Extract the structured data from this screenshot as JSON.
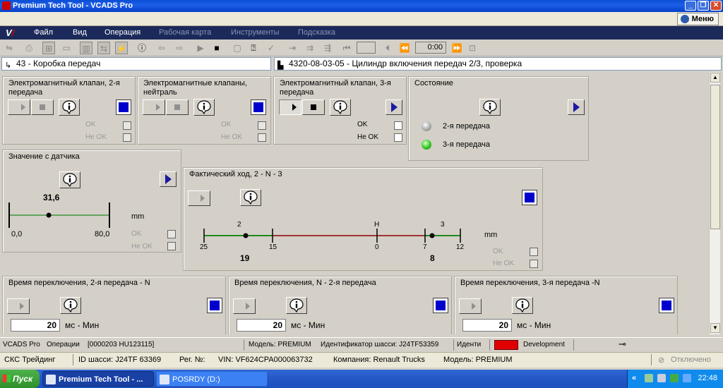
{
  "window": {
    "title": "Premium Tech Tool - VCADS Pro"
  },
  "menu_button": {
    "label": "Меню"
  },
  "menubar": {
    "items": [
      "Файл",
      "Вид",
      "Операция",
      "Рабочая карта",
      "Инструменты",
      "Подсказка"
    ]
  },
  "toolbar": {
    "time": "0:00"
  },
  "path": {
    "left": "43 - Коробка передач",
    "right": "4320-08-03-05 - Цилиндр включения передач 2/3, проверка"
  },
  "panels": {
    "valve2": {
      "title": "Электромагнитный клапан, 2-я передача",
      "ok": "OK",
      "not_ok": "Не OK"
    },
    "valveN": {
      "title": "Электромагнитные клапаны, нейтраль",
      "ok": "OK",
      "not_ok": "Не OK"
    },
    "valve3": {
      "title": "Электромагнитный клапан, 3-я передача",
      "ok": "OK",
      "not_ok": "Не OK"
    },
    "state": {
      "title": "Состояние",
      "gear2": "2-я передача",
      "gear3": "3-я передача",
      "gear2_on": false,
      "gear3_on": true
    },
    "sensor": {
      "title": "Значение с датчика",
      "value": "31,6",
      "min": "0,0",
      "max": "80,0",
      "unit": "mm",
      "ok": "OK",
      "not_ok": "Не OK",
      "position": 31.6,
      "range": [
        0,
        80
      ]
    },
    "stroke": {
      "title": "Фактический ход, 2 - N - 3",
      "unit": "mm",
      "top_labels": {
        "g2": "2",
        "neutral": "Н",
        "g3": "3"
      },
      "ticks": [
        "25",
        "15",
        "0",
        "7",
        "12"
      ],
      "value_left": "19",
      "value_right": "8",
      "ok": "OK",
      "not_ok": "Не OK"
    },
    "time_2n": {
      "title": "Время переключения, 2-я передача - N",
      "value": "20",
      "unit": "мс - Мин"
    },
    "time_n2": {
      "title": "Время переключения, N - 2-я передача",
      "value": "20",
      "unit": "мс - Мин"
    },
    "time_3n": {
      "title": "Время переключения, 3-я передача -N",
      "value": "20",
      "unit": "мс - Мин"
    }
  },
  "status1": {
    "app": "VCADS Pro",
    "operations_label": "Операции",
    "operations_value": "[0000203 HU123115]",
    "model": "Модель: PREMIUM",
    "chassis_id": "Идентификатор шасси: J24TF53359",
    "ident": "Иденти",
    "env": "Development"
  },
  "status2": {
    "company_short": "СКС Трейдинг",
    "chassis": "ID шасси: J24TF 63369",
    "reg": "Рег. №:",
    "vin": "VIN: VF624CPA000063732",
    "company": "Компания: Renault Trucks",
    "model": "Модель: PREMIUM",
    "connection": "Отключено"
  },
  "taskbar": {
    "start": "Пуск",
    "tasks": [
      "Premium Tech Tool - ...",
      "POSRDY (D:)"
    ],
    "clock": "22:48"
  },
  "colors": {
    "accent_blue": "#0000cc",
    "led_green": "#3ad02a",
    "status_red": "#e00000",
    "line_green": "#1e8a1e",
    "line_red": "#8b0000"
  }
}
